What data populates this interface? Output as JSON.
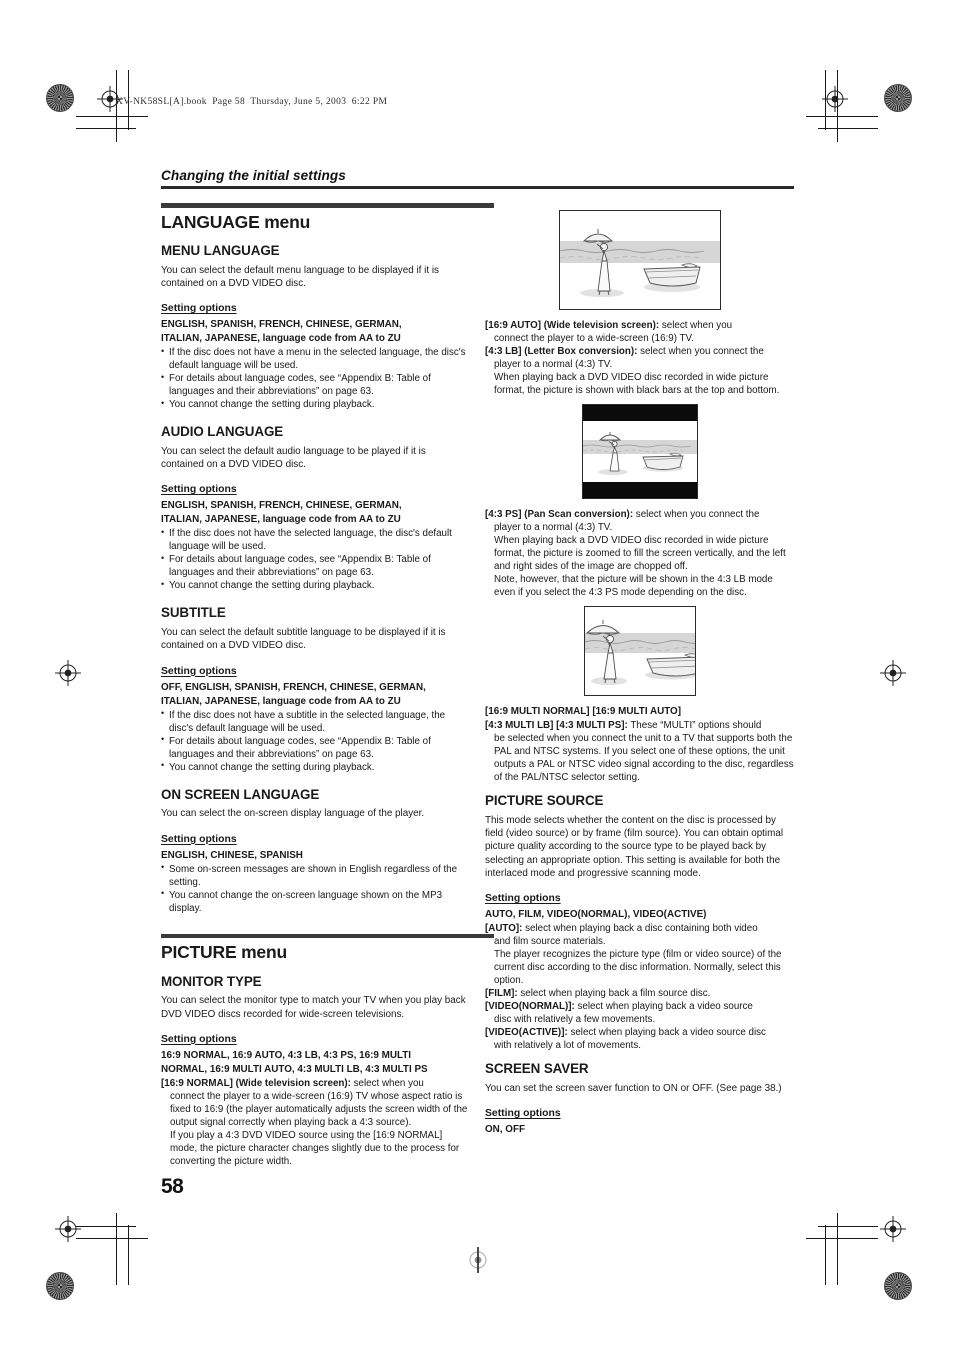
{
  "print_marks": {
    "file_header": "XV-NK58SL[A].book  Page 58  Thursday, June 5, 2003  6:22 PM",
    "corner_label": "XV-NK58"
  },
  "running_head": {
    "title": "Changing the initial settings"
  },
  "page_number": "58",
  "sections": [
    {
      "id": "language-menu",
      "menu_title": "LANGUAGE menu",
      "subsections": [
        {
          "id": "menu-language",
          "heading": "MENU LANGUAGE",
          "intro": "You can select the default menu language to be displayed if it is contained on a DVD VIDEO disc.",
          "setting_options_label": "Setting options",
          "options": [
            "ENGLISH, SPANISH, FRENCH, CHINESE, GERMAN,",
            "ITALIAN, JAPANESE, language code from AA to ZU"
          ],
          "bullets": [
            "If the disc does not have a menu in the selected language, the disc's default language will be used.",
            "For details about language codes, see “Appendix B: Table of languages and their abbreviations” on page 63.",
            "You cannot change the setting during playback."
          ]
        },
        {
          "id": "audio-language",
          "heading": "AUDIO LANGUAGE",
          "intro": "You can select the default audio language to be played if it is contained on a DVD VIDEO disc.",
          "setting_options_label": "Setting options",
          "options": [
            "ENGLISH, SPANISH, FRENCH, CHINESE, GERMAN,",
            "ITALIAN, JAPANESE, language code from AA to ZU"
          ],
          "bullets": [
            "If the disc does not have the selected language, the disc's default language will be used.",
            "For details about language codes, see “Appendix B: Table of languages and their abbreviations” on page 63.",
            "You cannot change the setting during playback."
          ]
        },
        {
          "id": "subtitle",
          "heading": "SUBTITLE",
          "intro": "You can select the default subtitle language to be displayed if it is contained on a DVD VIDEO disc.",
          "setting_options_label": "Setting options",
          "options": [
            "OFF, ENGLISH, SPANISH, FRENCH, CHINESE, GERMAN,",
            "ITALIAN, JAPANESE, language code from AA to ZU"
          ],
          "bullets": [
            "If the disc does not have a subtitle in the selected language, the disc's default language will be used.",
            "For details about language codes, see “Appendix B: Table of languages and their abbreviations” on page 63.",
            "You cannot change the setting during playback."
          ]
        },
        {
          "id": "on-screen-language",
          "heading": "ON SCREEN LANGUAGE",
          "intro": "You can select the on-screen display language of the player.",
          "setting_options_label": "Setting options",
          "options": [
            "ENGLISH, CHINESE, SPANISH"
          ],
          "bullets": [
            "Some on-screen messages are shown in English regardless of the setting.",
            "You cannot change the on-screen language shown on the MP3 display."
          ]
        }
      ]
    },
    {
      "id": "picture-menu",
      "menu_title": "PICTURE menu",
      "subsections": [
        {
          "id": "monitor-type",
          "heading": "MONITOR TYPE",
          "intro": "You can select the monitor type to match your TV when you play back DVD VIDEO discs recorded for wide-screen televisions.",
          "setting_options_label": "Setting options",
          "options": [
            "16:9 NORMAL, 16:9 AUTO, 4:3 LB, 4:3 PS, 16:9 MULTI",
            "NORMAL, 16:9 MULTI AUTO, 4:3 MULTI LB, 4:3 MULTI PS"
          ],
          "definitions": [
            {
              "term": "[16:9 NORMAL] (Wide television screen):",
              "rest": " select when you",
              "continuation": [
                "connect the player to a wide-screen (16:9) TV whose aspect ratio is fixed to 16:9 (the player automatically adjusts the screen width of the output signal correctly when playing back a 4:3 source).",
                "If you play a 4:3 DVD VIDEO source using the [16:9 NORMAL] mode, the picture character changes slightly due to the process for converting the picture width."
              ]
            }
          ]
        }
      ]
    }
  ],
  "right_column": {
    "monitor_type_cont": {
      "definitions": [
        {
          "term": "[16:9 AUTO] (Wide television screen):",
          "rest": " select when you",
          "continuation": [
            "connect the player to a wide-screen (16:9) TV."
          ]
        },
        {
          "term": "[4:3 LB] (Letter Box conversion):",
          "rest": " select when you connect the",
          "continuation": [
            "player to a normal (4:3) TV.",
            "When playing back a DVD VIDEO disc recorded in wide picture format, the picture is shown with black bars at the top and bottom."
          ]
        }
      ],
      "pan_scan": {
        "term": "[4:3 PS] (Pan Scan conversion):",
        "rest": " select when you connect the",
        "continuation": [
          "player to a normal (4:3) TV.",
          "When playing back a DVD VIDEO disc recorded in wide picture format, the picture is zoomed to fill the screen vertically, and the left and right sides of the image are chopped off.",
          "Note, however, that the picture will be shown in the 4:3 LB mode even if you select the 4:3 PS mode depending on the disc."
        ]
      },
      "multi": {
        "line1": "[16:9 MULTI NORMAL] [16:9 MULTI AUTO]",
        "term": "[4:3 MULTI LB] [4:3 MULTI PS]:",
        "rest": " These “MULTI” options should",
        "continuation": [
          "be selected when you connect the unit to a TV that supports both the PAL and NTSC systems. If you select one of these options, the unit outputs a PAL or NTSC video signal according to the disc, regardless of the PAL/NTSC selector setting."
        ]
      }
    },
    "picture_source": {
      "heading": "PICTURE SOURCE",
      "intro": "This mode selects whether the content on the disc is processed by field (video source) or by frame (film source). You can obtain optimal picture quality according to the source type to be played back by selecting an appropriate option. This setting is available for both the interlaced mode and progressive scanning mode.",
      "setting_options_label": "Setting options",
      "options": [
        "AUTO, FILM, VIDEO(NORMAL), VIDEO(ACTIVE)"
      ],
      "definitions": [
        {
          "term": "[AUTO]:",
          "rest": " select when playing back a disc containing both video",
          "continuation": [
            "and film source materials.",
            "The player recognizes the picture type (film or video source) of the current disc according to the disc information. Normally, select this option."
          ]
        },
        {
          "term": "[FILM]:",
          "rest": " select when playing back a film source disc.",
          "continuation": []
        },
        {
          "term": "[VIDEO(NORMAL)]:",
          "rest": " select when playing back a video source",
          "continuation": [
            "disc with relatively a few movements."
          ]
        },
        {
          "term": "[VIDEO(ACTIVE)]:",
          "rest": " select when playing back a video source disc",
          "continuation": [
            "with relatively a lot of movements."
          ]
        }
      ]
    },
    "screen_saver": {
      "heading": "SCREEN SAVER",
      "intro": "You can set the screen saver function to ON or OFF. (See page 38.)",
      "setting_options_label": "Setting options",
      "options": [
        "ON, OFF"
      ]
    }
  },
  "figures": [
    {
      "id": "fig-widescreen",
      "caption_alt": "beach scene on wide television screen",
      "mode": "wide"
    },
    {
      "id": "fig-letterbox",
      "caption_alt": "beach scene with black bars at top and bottom",
      "mode": "letterbox"
    },
    {
      "id": "fig-panscan",
      "caption_alt": "beach scene zoomed with sides chopped off",
      "mode": "panscan"
    }
  ]
}
